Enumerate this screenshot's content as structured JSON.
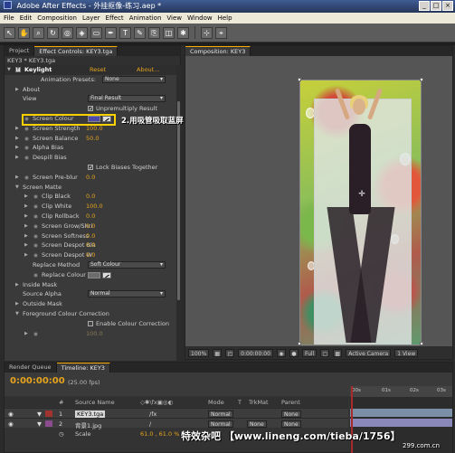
{
  "window": {
    "title": "Adobe After Effects - 外挂抠像-练习.aep *",
    "controls": [
      "_",
      "□",
      "×"
    ]
  },
  "menu": [
    "File",
    "Edit",
    "Composition",
    "Layer",
    "Effect",
    "Animation",
    "View",
    "Window",
    "Help"
  ],
  "tools": [
    "select-tool-icon",
    "hand-tool-icon",
    "zoom-tool-icon",
    "rotate-tool-icon",
    "camera-tool-icon",
    "pan-behind-tool-icon",
    "rectangle-mask-tool-icon",
    "pen-tool-icon",
    "type-tool-icon",
    "brush-tool-icon",
    "clone-stamp-tool-icon",
    "eraser-tool-icon",
    "puppet-tool-icon",
    "axis-mode-icon",
    "snap-icon"
  ],
  "tool_glyphs": [
    "↖",
    "✋",
    "🔍",
    "↻",
    "◎",
    "◈",
    "▭",
    "✒",
    "T",
    "✎",
    "⎘",
    "◫",
    "✱",
    "⊹",
    "⌖"
  ],
  "left_panel": {
    "tab_project": "Project",
    "tab_effect_controls": "Effect Controls: KEY3.tga",
    "subtitle": "KEY3 * KEY3.tga",
    "effect_name": "Keylight",
    "reset": "Reset",
    "about": "About...",
    "rows": {
      "animation_presets": {
        "label": "Animation Presets:",
        "value": "None"
      },
      "about": "About",
      "view": {
        "label": "View",
        "value": "Final Result"
      },
      "unpremultiply": "Unpremultiply Result",
      "screen_colour": "Screen Colour",
      "screen_strength": {
        "label": "Screen Strength",
        "value": "100.0"
      },
      "screen_balance": {
        "label": "Screen Balance",
        "value": "50.0"
      },
      "alpha_bias": {
        "label": "Alpha Bias",
        "value": ""
      },
      "despill_bias": {
        "label": "Despill Bias",
        "value": ""
      },
      "lock_biases": "Lock Biases Together",
      "screen_preblur": {
        "label": "Screen Pre-blur",
        "value": "0.0"
      },
      "screen_matte": "Screen Matte",
      "clip_black": {
        "label": "Clip Black",
        "value": "0.0"
      },
      "clip_white": {
        "label": "Clip White",
        "value": "100.0"
      },
      "clip_rollback": {
        "label": "Clip Rollback",
        "value": "0.0"
      },
      "screen_grow_shrink": {
        "label": "Screen Grow/Shri",
        "value": "0.0"
      },
      "screen_softness": {
        "label": "Screen Softness",
        "value": "0.0"
      },
      "screen_despot_black": {
        "label": "Screen Despot Bla",
        "value": "0.0"
      },
      "screen_despot_white": {
        "label": "Screen Despot W",
        "value": "0.0"
      },
      "replace_method": {
        "label": "Replace Method",
        "value": "Soft Colour"
      },
      "replace_colour": "Replace Colour",
      "inside_mask": "Inside Mask",
      "source_alpha": {
        "label": "Source Alpha",
        "value": "Normal"
      },
      "outside_mask": "Outside Mask",
      "foreground_colour_correction": "Foreground Colour Correction",
      "enable_colour_correction": "Enable Colour Correction",
      "last_value": "100.0"
    },
    "annotation": "2.用吸管吸取蓝屏",
    "colors": {
      "screen_colour": "#4f49a8",
      "accent": "#e5a41e",
      "highlight": "#ffd100"
    }
  },
  "comp_panel": {
    "tab": "Composition: KEY3",
    "viewer_bar": {
      "zoom": "100%",
      "timecode": "0:00:00:00",
      "resolution": "Full",
      "camera": "Active Camera",
      "views": "1 View"
    }
  },
  "timeline": {
    "tab_render": "Render Queue",
    "tab_timeline": "Timeline: KEY3",
    "timecode": "0:00:00:00",
    "fps": "(25.00 fps)",
    "columns": {
      "num": "#",
      "source": "Source Name",
      "mode": "Mode",
      "t": "T",
      "trkmat": "TrkMat",
      "parent": "Parent"
    },
    "layers": [
      {
        "num": "1",
        "name": "KEY3.tga",
        "mode": "Normal",
        "trkmat": "",
        "parent": "None"
      },
      {
        "num": "2",
        "name": "背景1.jpg",
        "mode": "Normal",
        "trkmat": "None",
        "parent": "None"
      }
    ],
    "scale": {
      "label": "Scale",
      "value": "61.0 , 61.0 %"
    },
    "ruler": [
      "00s",
      "01s",
      "02s",
      "03s"
    ]
  },
  "watermark": "特效杂吧 【www.lineng.com/tieba/1756】",
  "watermark2": "299.com.cn"
}
